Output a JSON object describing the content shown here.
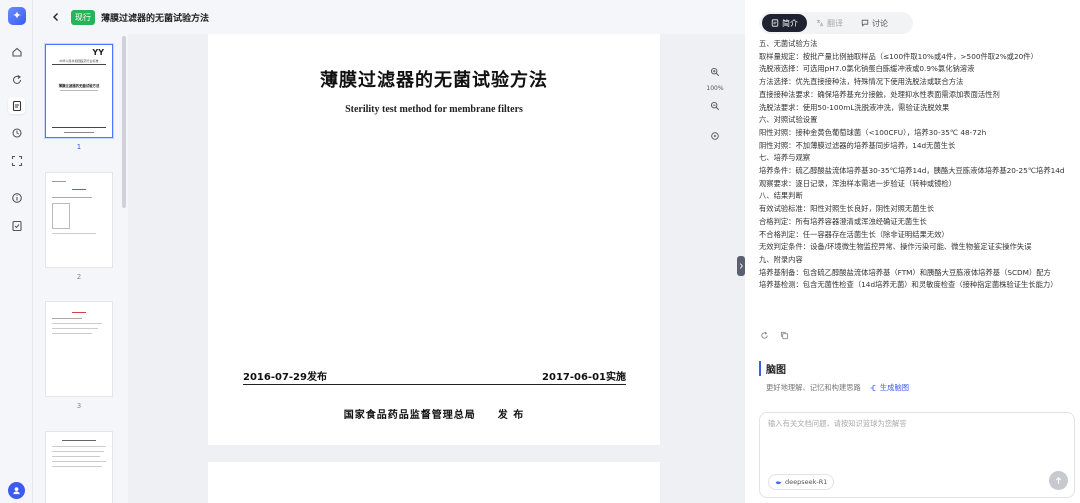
{
  "header": {
    "badge": "现行",
    "title": "薄膜过滤器的无菌试验方法"
  },
  "thumbnails": [
    {
      "num": "1",
      "selected": true
    },
    {
      "num": "2",
      "selected": false
    },
    {
      "num": "3",
      "selected": false
    },
    {
      "num": "",
      "selected": false
    }
  ],
  "thumb1": {
    "logo": "YY",
    "org": "中华人民共和国医药行业标准",
    "title": "薄膜过滤器的无菌试验方法"
  },
  "page": {
    "title": "薄膜过滤器的无菌试验方法",
    "subtitle": "Sterility test method for membrane filters",
    "publish_date": "2016-07-29发布",
    "effective_date": "2017-06-01实施",
    "issuer": "国家食品药品监督管理总局　　发 布"
  },
  "zoom": {
    "level": "100%"
  },
  "panel": {
    "tabs": {
      "summary": "简介",
      "translate": "翻译",
      "discuss": "讨论"
    },
    "lines": [
      "五、无菌试验方法",
      "取样量规定：按批产量比例抽取样品（≤100件取10%或4件，>500件取2%或20件）",
      "洗脱液选择：可选用pH7.0氯化钠蛋白胨缓冲液或0.9%氯化钠溶液",
      "方法选择：优先直接接种法，特殊情况下使用洗脱法或联合方法",
      "直接接种法要求：确保培养基充分接触，处理抑水性表面需添加表面活性剂",
      "洗脱法要求：使用50-100mL洗脱液冲洗，需验证洗脱效果",
      "六、对照试验设置",
      "阳性对照：接种金黄色葡萄球菌（<100CFU），培养30-35℃ 48-72h",
      "阴性对照：不加薄膜过滤器的培养基同步培养，14d无菌生长",
      "七、培养与观察",
      "培养条件：硫乙醇酸盐流体培养基30-35℃培养14d，胰酪大豆胨液体培养基20-25℃培养14d",
      "观察要求：逐日记录，浑浊样本需进一步验证（转种或镜检）",
      "八、结果判断",
      "有效试验标准：阳性对照生长良好，阴性对照无菌生长",
      "合格判定：所有培养容器澄清或浑浊经确证无菌生长",
      "不合格判定：任一容器存在活菌生长（除非证明结果无效）",
      "无效判定条件：设备/环境微生物监控异常、操作污染可能、微生物鉴定证实操作失误",
      "九、附录内容",
      "培养基制备：包含硫乙醇酸盐流体培养基（FTM）和胰酪大豆胨液体培养基（SCDM）配方",
      "培养基检测：包含无菌性检查（14d培养无菌）和灵敏度检查（接种指定菌株验证生长能力）"
    ],
    "mindmap": {
      "title": "脑图",
      "desc": "更好地理解、记忆和构建思路",
      "generate": "生成脑图"
    },
    "input": {
      "placeholder": "输入有关文档问题，请按知识篮球为您解答"
    },
    "model": "deepseek-R1"
  }
}
